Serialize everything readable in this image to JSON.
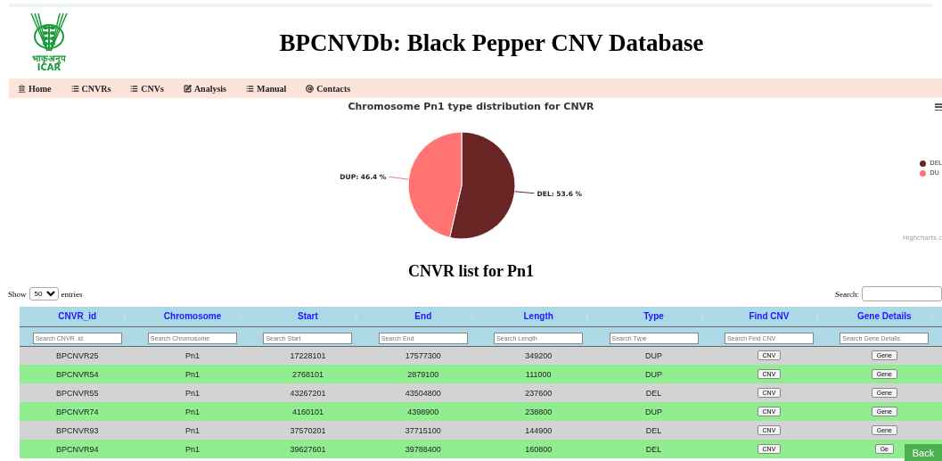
{
  "header": {
    "logo": {
      "hindi": "भाकृअनुप",
      "abbr": "ICAR"
    },
    "title": "BPCNVDb: Black Pepper CNV Database"
  },
  "nav": [
    {
      "label": "Home"
    },
    {
      "label": "CNVRs"
    },
    {
      "label": "CNVs"
    },
    {
      "label": "Analysis"
    },
    {
      "label": "Manual"
    },
    {
      "label": "Contacts"
    }
  ],
  "chart": {
    "chart_data": {
      "type": "pie",
      "title": "Chromosome Pn1 type distribution for CNVR",
      "series": [
        {
          "values": [
            53.6,
            46.4
          ]
        }
      ],
      "colors": [
        "#6b2524",
        "#ff7373"
      ],
      "value_labels": [
        "DEL: 53.6 %",
        "DUP: 46.4 %"
      ]
    },
    "legend": [
      {
        "label": "DEL",
        "color": "#6b2524"
      },
      {
        "label": "DU",
        "color": "#ff7373"
      }
    ],
    "credit": "Highcharts.c"
  },
  "list_title": "CNVR list for Pn1",
  "controls": {
    "show_label": "Show",
    "page_size": "50",
    "entries_label": "entries",
    "search_label": "Search:"
  },
  "table": {
    "columns": [
      {
        "label": "CNVR_id",
        "placeholder": "Search CNVR_id"
      },
      {
        "label": "Chromosome",
        "placeholder": "Search Chromosome"
      },
      {
        "label": "Start",
        "placeholder": "Search Start"
      },
      {
        "label": "End",
        "placeholder": "Search End"
      },
      {
        "label": "Length",
        "placeholder": "Search Length"
      },
      {
        "label": "Type",
        "placeholder": "Search Type"
      },
      {
        "label": "Find CNV",
        "placeholder": "Search Find CNV"
      },
      {
        "label": "Gene Details",
        "placeholder": "Search Gene Details"
      }
    ],
    "rows": [
      {
        "cells": [
          "BPCNVR25",
          "Pn1",
          "17228101",
          "17577300",
          "349200",
          "DUP"
        ],
        "cnv": "CNV",
        "gene": "Gene"
      },
      {
        "cells": [
          "BPCNVR54",
          "Pn1",
          "2768101",
          "2879100",
          "111000",
          "DUP"
        ],
        "cnv": "CNV",
        "gene": "Gene"
      },
      {
        "cells": [
          "BPCNVR55",
          "Pn1",
          "43267201",
          "43504800",
          "237600",
          "DEL"
        ],
        "cnv": "CNV",
        "gene": "Gene"
      },
      {
        "cells": [
          "BPCNVR74",
          "Pn1",
          "4160101",
          "4398900",
          "238800",
          "DUP"
        ],
        "cnv": "CNV",
        "gene": "Gene"
      },
      {
        "cells": [
          "BPCNVR93",
          "Pn1",
          "37570201",
          "37715100",
          "144900",
          "DEL"
        ],
        "cnv": "CNV",
        "gene": "Gene"
      },
      {
        "cells": [
          "BPCNVR94",
          "Pn1",
          "39627601",
          "39788400",
          "160800",
          "DEL"
        ],
        "cnv": "CNV",
        "gene": "Ge"
      }
    ]
  },
  "back_button": "Back"
}
